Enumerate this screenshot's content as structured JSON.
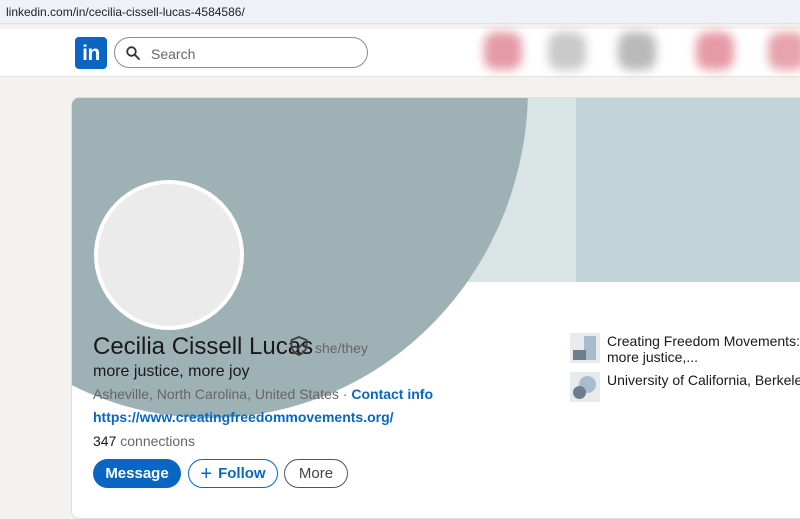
{
  "browser": {
    "url": "linkedin.com/in/cecilia-cissell-lucas-4584586/"
  },
  "nav": {
    "logo_text": "in",
    "search_placeholder": "Search"
  },
  "profile": {
    "name": "Cecilia Cissell Lucas",
    "pronouns": "she/they",
    "headline": "more justice, more joy",
    "location": "Asheville, North Carolina, United States",
    "separator": " · ",
    "contact_info": "Contact info",
    "website": "https://www.creatingfreedommovements.org/",
    "connections_count": "347",
    "connections_label": " connections"
  },
  "actions": {
    "message": "Message",
    "follow": "Follow",
    "more": "More"
  },
  "affiliations": [
    {
      "name": "Creating Freedom Movements: more justice,...",
      "icon": "company-logo"
    },
    {
      "name": "University of California, Berkeley",
      "icon": "school-logo"
    }
  ],
  "colors": {
    "brand": "#0a66c2",
    "cover": "#9eb1b5"
  }
}
